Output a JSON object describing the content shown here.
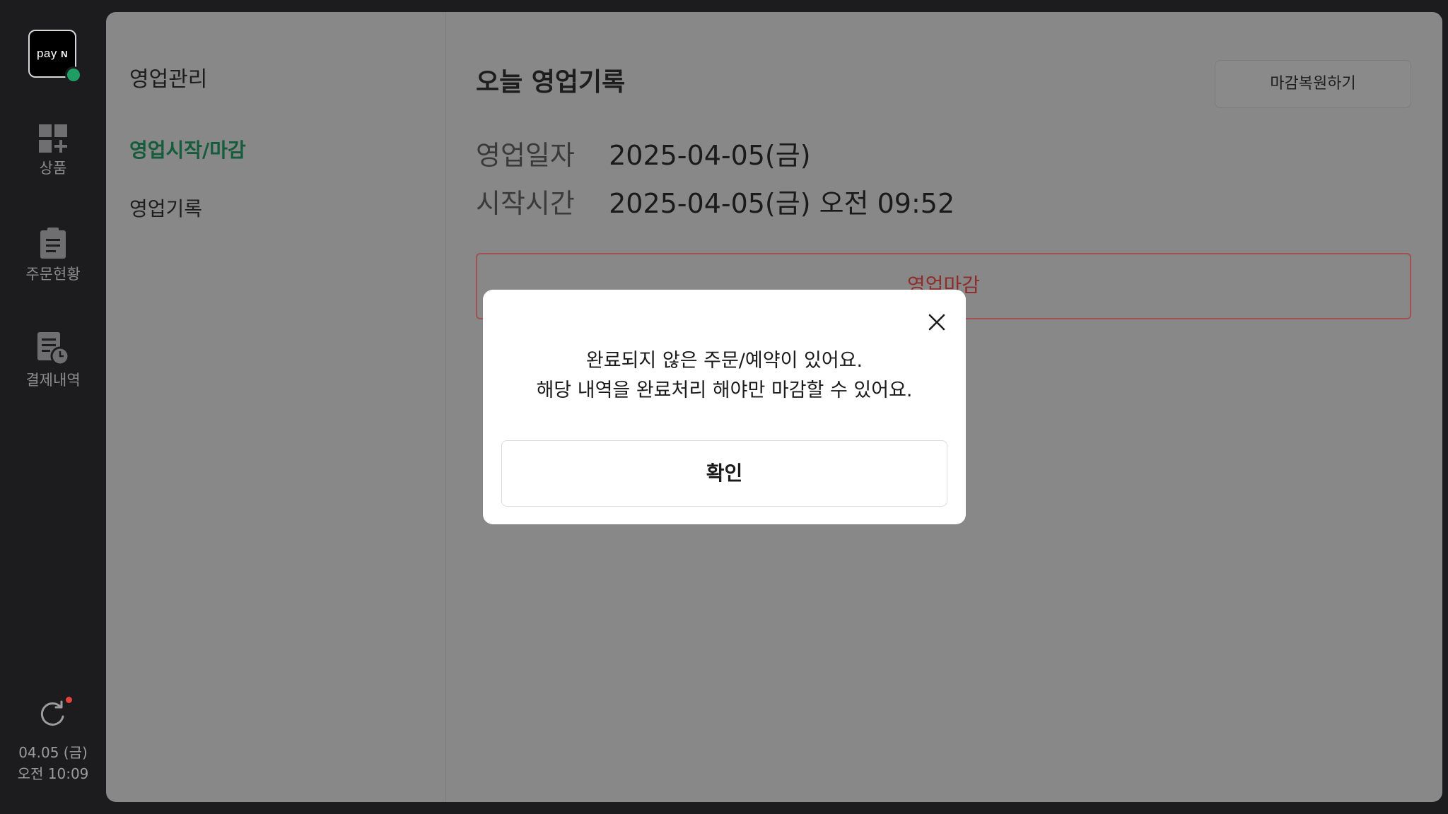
{
  "rail": {
    "logo_text": "pay",
    "logo_mark": "N",
    "items": [
      {
        "label": "상품",
        "icon": "grid-plus-icon"
      },
      {
        "label": "주문현황",
        "icon": "clipboard-icon"
      },
      {
        "label": "결제내역",
        "icon": "receipt-clock-icon"
      }
    ],
    "refresh_icon": "refresh-icon",
    "date": "04.05 (금)",
    "time": "오전 10:09"
  },
  "subnav": {
    "title": "영업관리",
    "items": [
      {
        "label": "영업시작/마감",
        "active": true
      },
      {
        "label": "영업기록",
        "active": false
      }
    ]
  },
  "content": {
    "title": "오늘 영업기록",
    "restore_label": "마감복원하기",
    "date_label": "영업일자",
    "date_value": "2025-04-05(금)",
    "start_label": "시작시간",
    "start_value": "2025-04-05(금) 오전 09:52",
    "close_label": "영업마감"
  },
  "modal": {
    "line1": "완료되지 않은 주문/예약이 있어요.",
    "line2": "해당 내역을 완료처리 해야만 마감할 수 있어요.",
    "ok_label": "확인"
  },
  "colors": {
    "accent_green": "#1e9e62",
    "alert_red": "#e2433d",
    "rail_bg": "#1c1c1e"
  }
}
